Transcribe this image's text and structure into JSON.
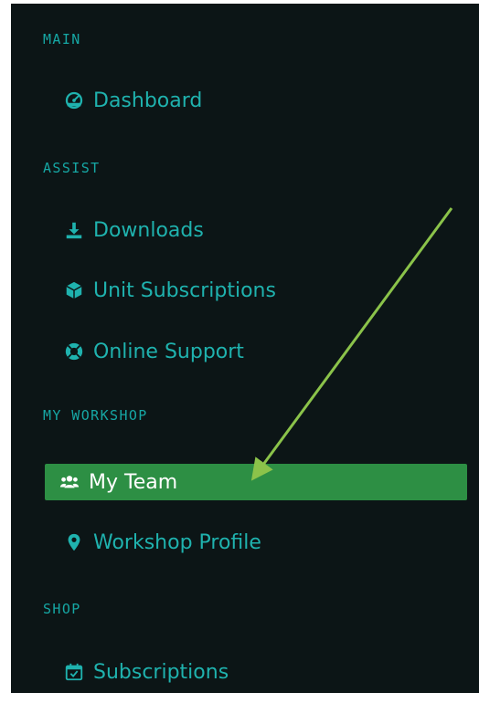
{
  "sidebar": {
    "sections": {
      "main": "MAIN",
      "assist": "ASSIST",
      "my_workshop": "MY WORKSHOP",
      "shop": "SHOP"
    },
    "items": {
      "dashboard": "Dashboard",
      "downloads": "Downloads",
      "unit_subscriptions": "Unit Subscriptions",
      "online_support": "Online Support",
      "my_team": "My Team",
      "workshop_profile": "Workshop Profile",
      "subscriptions": "Subscriptions"
    },
    "active_item": "my_team"
  },
  "colors": {
    "background": "#0c1516",
    "text_teal": "#1fb2ae",
    "section_teal": "#16a7a4",
    "active_bg": "#2d8f44",
    "active_text": "#ffffff",
    "annotation_arrow": "#8bc34a"
  },
  "icons": {
    "dashboard": "tachometer-icon",
    "downloads": "download-icon",
    "unit_subscriptions": "cube-icon",
    "online_support": "life-ring-icon",
    "my_team": "users-icon",
    "workshop_profile": "map-marker-icon",
    "subscriptions": "calendar-check-icon"
  }
}
